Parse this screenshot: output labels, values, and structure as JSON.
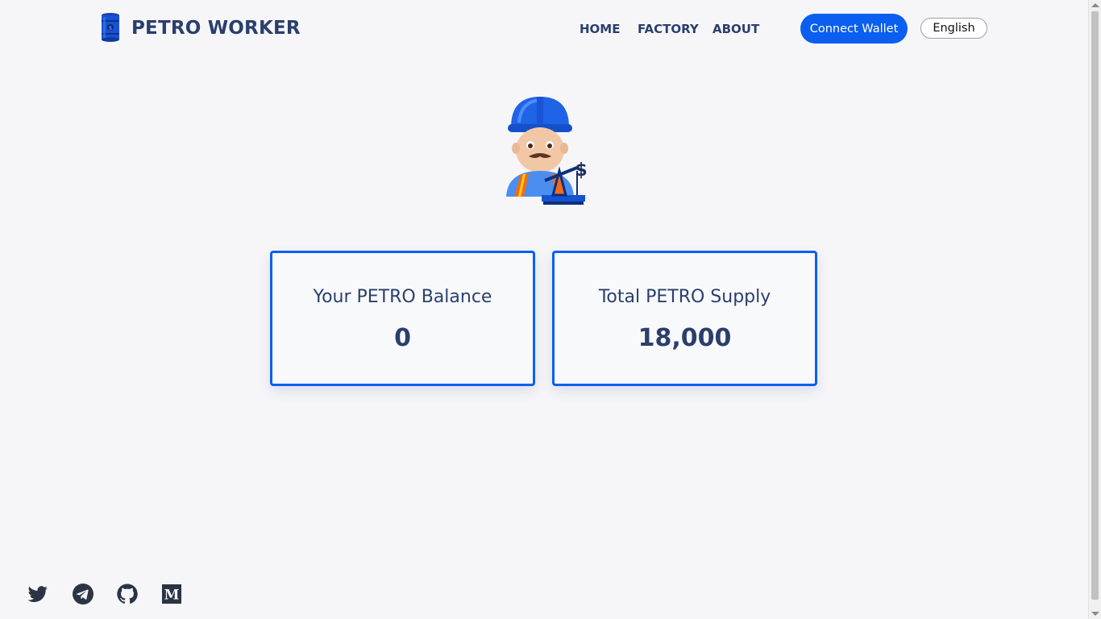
{
  "header": {
    "brand": "PETRO WORKER",
    "logo_icon": "oil-barrel-icon",
    "nav": {
      "home": "HOME",
      "factory": "FACTORY",
      "about": "ABOUT"
    },
    "connect_wallet": "Connect Wallet",
    "language": "English"
  },
  "hero": {
    "icon": "oil-worker-icon"
  },
  "cards": {
    "balance": {
      "title": "Your PETRO Balance",
      "value": "0"
    },
    "supply": {
      "title": "Total PETRO Supply",
      "value": "18,000"
    }
  },
  "socials": [
    "twitter-icon",
    "telegram-icon",
    "github-icon",
    "medium-icon"
  ],
  "colors": {
    "accent": "#0a5ff0",
    "text": "#2b3f6c",
    "background": "#f6f6f9"
  }
}
